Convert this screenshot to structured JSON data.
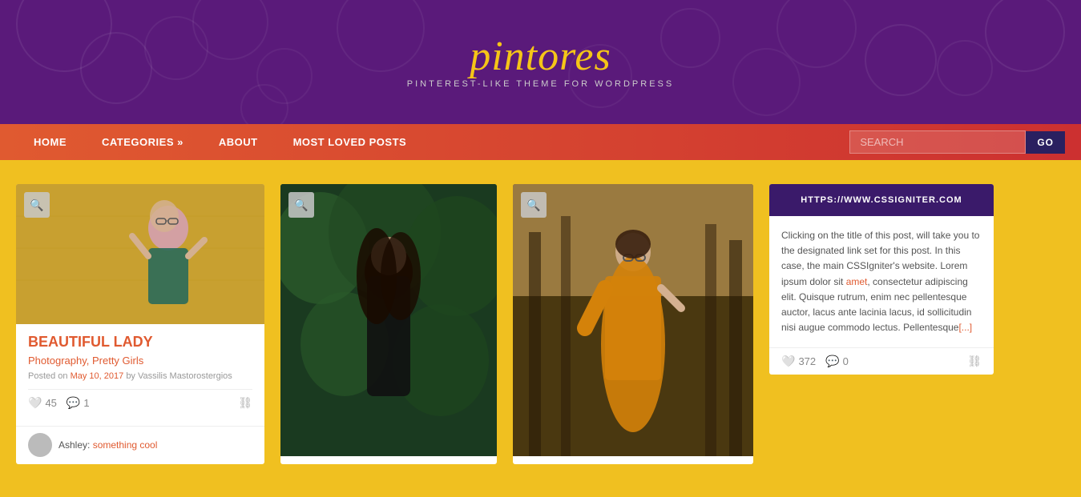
{
  "header": {
    "logo": "pintores",
    "tagline": "PINTEREST-LIKE THEME FOR WORDPRESS",
    "bg_color": "#5a1a7a"
  },
  "nav": {
    "items": [
      {
        "label": "HOME",
        "has_arrow": false
      },
      {
        "label": "CATEGORIES »",
        "has_arrow": true
      },
      {
        "label": "ABOUT",
        "has_arrow": false
      },
      {
        "label": "MOST LOVED POSTS",
        "has_arrow": false
      }
    ],
    "search_placeholder": "SEARCH",
    "search_button": "GO"
  },
  "posts": [
    {
      "title": "BEAUTIFUL LADY",
      "categories": "Photography, Pretty Girls",
      "meta": "Posted on May 10, 2017 by Vassilis Mastorostergios",
      "date": "May 10, 2017",
      "author": "Vassilis Mastorostergios",
      "likes": "45",
      "comments": "1",
      "comment_preview": "Ashley: something cool",
      "image_color": "#c8a030"
    },
    {
      "title": "",
      "categories": "",
      "meta": "",
      "likes": "",
      "comments": "",
      "image_color": "#1a3a20"
    },
    {
      "title": "",
      "categories": "",
      "meta": "",
      "likes": "",
      "comments": "",
      "image_color": "#7a6030"
    }
  ],
  "link_card": {
    "url": "HTTPS://WWW.CSSIGNITER.COM",
    "body": "Clicking on the title of this post, will take you to the designated link set for this post. In this case, the main CSSIgniter's website. Lorem ipsum dolor sit amet, consectetur adipiscing elit. Quisque rutrum, enim nec pellentesque auctor, lacus ante lacinia lacus, id sollicitudin nisi augue commodo lectus. Pellentesque[...]",
    "likes": "372",
    "comments": "0",
    "link_text_amet": "amet",
    "link_text_dots": "[...]"
  },
  "colors": {
    "accent": "#e05a30",
    "header_bg": "#5a1a7a",
    "nav_bg": "#cc3030",
    "body_bg": "#f0c020",
    "link_header_bg": "#3a1a6a"
  }
}
